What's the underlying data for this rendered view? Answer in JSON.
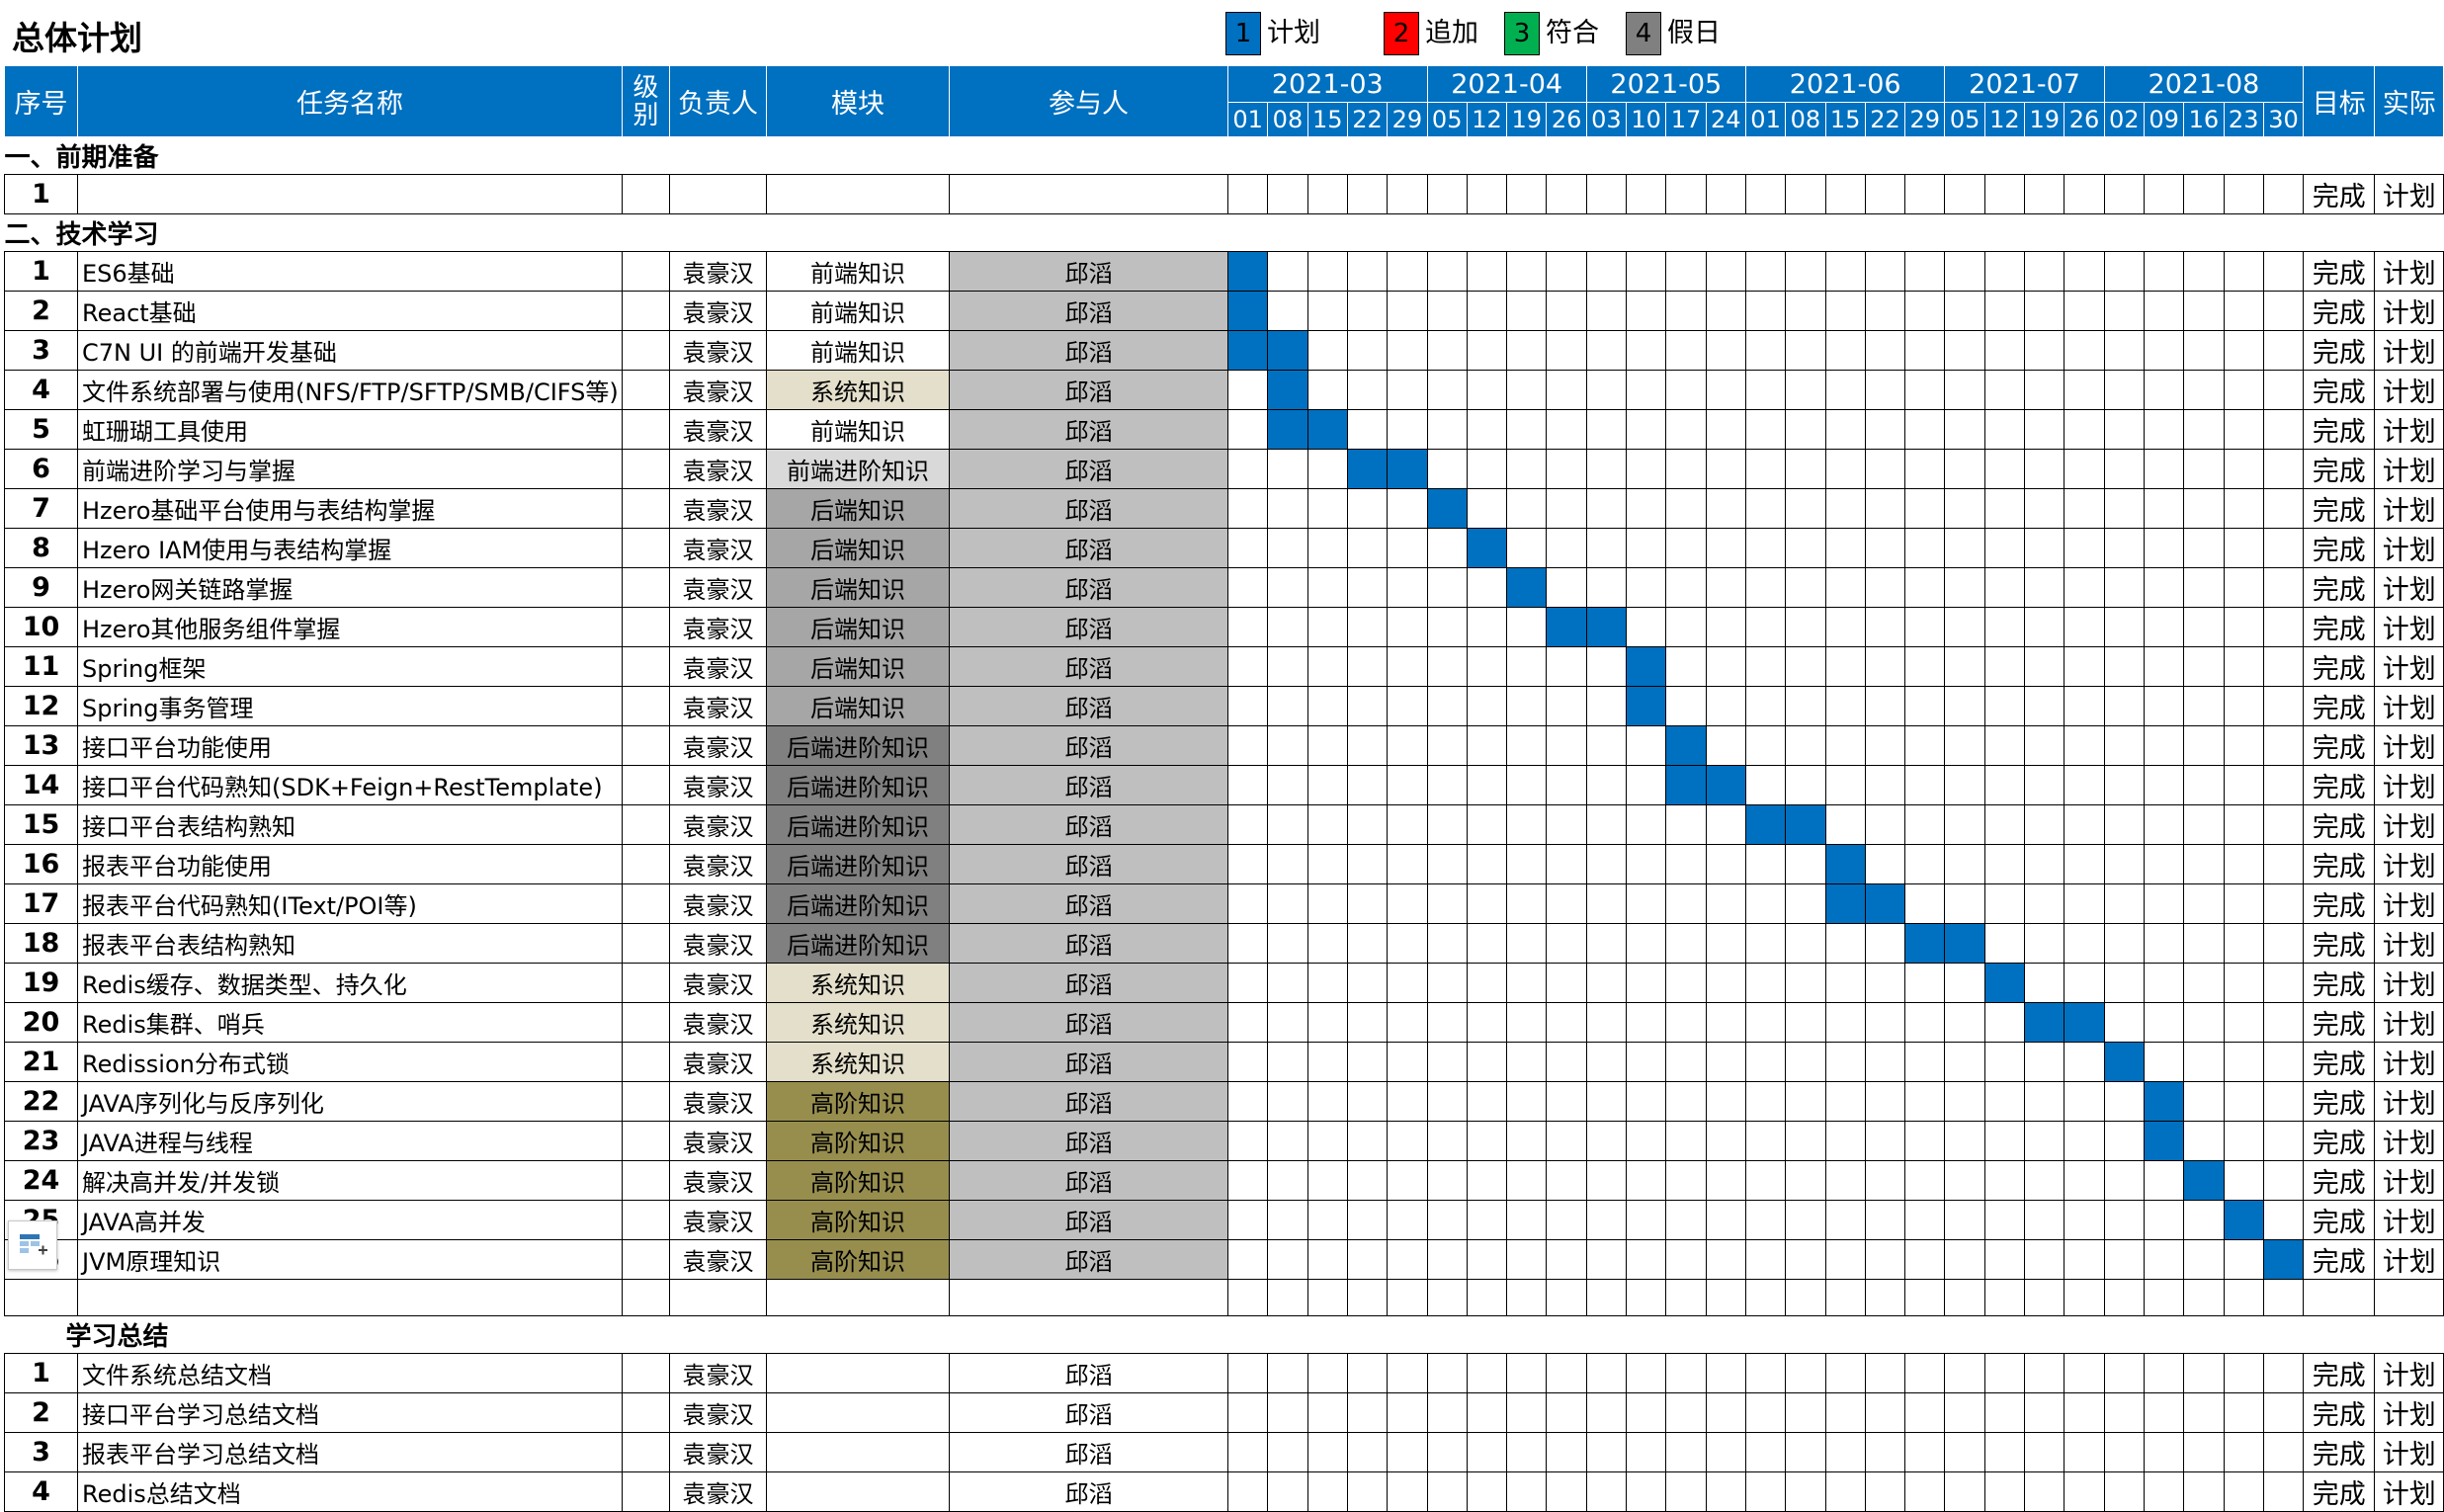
{
  "sheet_title": "总体计划",
  "legend": [
    {
      "num": "1",
      "label": "计划",
      "color": "#0070C0"
    },
    {
      "num": "2",
      "label": "追加",
      "color": "#FF0000"
    },
    {
      "num": "3",
      "label": "符合",
      "color": "#00B050"
    },
    {
      "num": "4",
      "label": "假日",
      "color": "#808080"
    }
  ],
  "headers": {
    "seq": "序号",
    "task": "任务名称",
    "level_1": "级",
    "level_2": "别",
    "owner": "负责人",
    "module": "模块",
    "participants": "参与人",
    "target": "目标",
    "actual": "实际"
  },
  "months": [
    {
      "label": "2021-03",
      "span": 5
    },
    {
      "label": "2021-04",
      "span": 4
    },
    {
      "label": "2021-05",
      "span": 4
    },
    {
      "label": "2021-06",
      "span": 5
    },
    {
      "label": "2021-07",
      "span": 4
    },
    {
      "label": "2021-08",
      "span": 5
    }
  ],
  "weeks": [
    "01",
    "08",
    "15",
    "22",
    "29",
    "05",
    "12",
    "19",
    "26",
    "03",
    "10",
    "17",
    "24",
    "01",
    "08",
    "15",
    "22",
    "29",
    "05",
    "12",
    "19",
    "26",
    "02",
    "09",
    "16",
    "23",
    "30"
  ],
  "sections": [
    {
      "title": "一、前期准备",
      "rows": [
        {
          "seq": "1",
          "task": "",
          "owner": "",
          "module": "",
          "module_style": "none",
          "participant": "",
          "participant_fill": false,
          "gantt": [],
          "target": "完成",
          "actual": "计划"
        }
      ]
    },
    {
      "title": "二、技术学习",
      "rows": [
        {
          "seq": "1",
          "task": "ES6基础",
          "owner": "袁豪汉",
          "module": "前端知识",
          "module_style": "front",
          "participant": "邱滔",
          "participant_fill": true,
          "gantt": [
            0
          ],
          "target": "完成",
          "actual": "计划"
        },
        {
          "seq": "2",
          "task": "React基础",
          "owner": "袁豪汉",
          "module": "前端知识",
          "module_style": "front",
          "participant": "邱滔",
          "participant_fill": true,
          "gantt": [
            0
          ],
          "target": "完成",
          "actual": "计划"
        },
        {
          "seq": "3",
          "task": "C7N UI 的前端开发基础",
          "owner": "袁豪汉",
          "module": "前端知识",
          "module_style": "front",
          "participant": "邱滔",
          "participant_fill": true,
          "gantt": [
            0,
            1
          ],
          "target": "完成",
          "actual": "计划"
        },
        {
          "seq": "4",
          "task": "文件系统部署与使用(NFS/FTP/SFTP/SMB/CIFS等)",
          "owner": "袁豪汉",
          "module": "系统知识",
          "module_style": "sys",
          "participant": "邱滔",
          "participant_fill": true,
          "gantt": [
            1
          ],
          "target": "完成",
          "actual": "计划"
        },
        {
          "seq": "5",
          "task": "虹珊瑚工具使用",
          "owner": "袁豪汉",
          "module": "前端知识",
          "module_style": "front",
          "participant": "邱滔",
          "participant_fill": true,
          "gantt": [
            1,
            2
          ],
          "target": "完成",
          "actual": "计划"
        },
        {
          "seq": "6",
          "task": "前端进阶学习与掌握",
          "owner": "袁豪汉",
          "module": "前端进阶知识",
          "module_style": "frontadv",
          "participant": "邱滔",
          "participant_fill": true,
          "gantt": [
            3,
            4
          ],
          "target": "完成",
          "actual": "计划"
        },
        {
          "seq": "7",
          "task": "Hzero基础平台使用与表结构掌握",
          "owner": "袁豪汉",
          "module": "后端知识",
          "module_style": "back",
          "participant": "邱滔",
          "participant_fill": true,
          "gantt": [
            5
          ],
          "target": "完成",
          "actual": "计划"
        },
        {
          "seq": "8",
          "task": "Hzero IAM使用与表结构掌握",
          "owner": "袁豪汉",
          "module": "后端知识",
          "module_style": "back",
          "participant": "邱滔",
          "participant_fill": true,
          "gantt": [
            6
          ],
          "target": "完成",
          "actual": "计划"
        },
        {
          "seq": "9",
          "task": "Hzero网关链路掌握",
          "owner": "袁豪汉",
          "module": "后端知识",
          "module_style": "back",
          "participant": "邱滔",
          "participant_fill": true,
          "gantt": [
            7
          ],
          "target": "完成",
          "actual": "计划"
        },
        {
          "seq": "10",
          "task": "Hzero其他服务组件掌握",
          "owner": "袁豪汉",
          "module": "后端知识",
          "module_style": "back",
          "participant": "邱滔",
          "participant_fill": true,
          "gantt": [
            8,
            9
          ],
          "target": "完成",
          "actual": "计划"
        },
        {
          "seq": "11",
          "task": "Spring框架",
          "owner": "袁豪汉",
          "module": "后端知识",
          "module_style": "back",
          "participant": "邱滔",
          "participant_fill": true,
          "gantt": [
            10
          ],
          "target": "完成",
          "actual": "计划"
        },
        {
          "seq": "12",
          "task": "Spring事务管理",
          "owner": "袁豪汉",
          "module": "后端知识",
          "module_style": "back",
          "participant": "邱滔",
          "participant_fill": true,
          "gantt": [
            10
          ],
          "target": "完成",
          "actual": "计划"
        },
        {
          "seq": "13",
          "task": "接口平台功能使用",
          "owner": "袁豪汉",
          "module": "后端进阶知识",
          "module_style": "backadv",
          "participant": "邱滔",
          "participant_fill": true,
          "gantt": [
            11
          ],
          "target": "完成",
          "actual": "计划"
        },
        {
          "seq": "14",
          "task": "接口平台代码熟知(SDK+Feign+RestTemplate)",
          "owner": "袁豪汉",
          "module": "后端进阶知识",
          "module_style": "backadv",
          "participant": "邱滔",
          "participant_fill": true,
          "gantt": [
            11,
            12
          ],
          "target": "完成",
          "actual": "计划"
        },
        {
          "seq": "15",
          "task": "接口平台表结构熟知",
          "owner": "袁豪汉",
          "module": "后端进阶知识",
          "module_style": "backadv",
          "participant": "邱滔",
          "participant_fill": true,
          "gantt": [
            13,
            14
          ],
          "target": "完成",
          "actual": "计划"
        },
        {
          "seq": "16",
          "task": "报表平台功能使用",
          "owner": "袁豪汉",
          "module": "后端进阶知识",
          "module_style": "backadv",
          "participant": "邱滔",
          "participant_fill": true,
          "gantt": [
            15
          ],
          "target": "完成",
          "actual": "计划"
        },
        {
          "seq": "17",
          "task": "报表平台代码熟知(IText/POI等)",
          "owner": "袁豪汉",
          "module": "后端进阶知识",
          "module_style": "backadv",
          "participant": "邱滔",
          "participant_fill": true,
          "gantt": [
            15,
            16
          ],
          "target": "完成",
          "actual": "计划"
        },
        {
          "seq": "18",
          "task": "报表平台表结构熟知",
          "owner": "袁豪汉",
          "module": "后端进阶知识",
          "module_style": "backadv",
          "participant": "邱滔",
          "participant_fill": true,
          "gantt": [
            17,
            18
          ],
          "target": "完成",
          "actual": "计划"
        },
        {
          "seq": "19",
          "task": "Redis缓存、数据类型、持久化",
          "owner": "袁豪汉",
          "module": "系统知识",
          "module_style": "sys",
          "participant": "邱滔",
          "participant_fill": true,
          "gantt": [
            19
          ],
          "target": "完成",
          "actual": "计划"
        },
        {
          "seq": "20",
          "task": "Redis集群、哨兵",
          "owner": "袁豪汉",
          "module": "系统知识",
          "module_style": "sys",
          "participant": "邱滔",
          "participant_fill": true,
          "gantt": [
            20,
            21
          ],
          "target": "完成",
          "actual": "计划"
        },
        {
          "seq": "21",
          "task": "Redission分布式锁",
          "owner": "袁豪汉",
          "module": "系统知识",
          "module_style": "sys",
          "participant": "邱滔",
          "participant_fill": true,
          "gantt": [
            22
          ],
          "target": "完成",
          "actual": "计划"
        },
        {
          "seq": "22",
          "task": "JAVA序列化与反序列化",
          "owner": "袁豪汉",
          "module": "高阶知识",
          "module_style": "high",
          "participant": "邱滔",
          "participant_fill": true,
          "gantt": [
            23
          ],
          "target": "完成",
          "actual": "计划"
        },
        {
          "seq": "23",
          "task": "JAVA进程与线程",
          "owner": "袁豪汉",
          "module": "高阶知识",
          "module_style": "high",
          "participant": "邱滔",
          "participant_fill": true,
          "gantt": [
            23
          ],
          "target": "完成",
          "actual": "计划"
        },
        {
          "seq": "24",
          "task": "解决高并发/并发锁",
          "owner": "袁豪汉",
          "module": "高阶知识",
          "module_style": "high",
          "participant": "邱滔",
          "participant_fill": true,
          "gantt": [
            24
          ],
          "target": "完成",
          "actual": "计划"
        },
        {
          "seq": "25",
          "task": "JAVA高并发",
          "owner": "袁豪汉",
          "module": "高阶知识",
          "module_style": "high",
          "participant": "邱滔",
          "participant_fill": true,
          "gantt": [
            25
          ],
          "target": "完成",
          "actual": "计划"
        },
        {
          "seq": "26",
          "task": "JVM原理知识",
          "owner": "袁豪汉",
          "module": "高阶知识",
          "module_style": "high",
          "participant": "邱滔",
          "participant_fill": true,
          "gantt": [
            26
          ],
          "target": "完成",
          "actual": "计划"
        },
        {
          "seq": "",
          "task": "",
          "owner": "",
          "module": "",
          "module_style": "none",
          "participant": "",
          "participant_fill": false,
          "gantt": [],
          "target": "",
          "actual": "",
          "blank": true
        }
      ]
    },
    {
      "title": "学习总结",
      "title_hidden_prefix": true,
      "rows": [
        {
          "seq": "1",
          "task": "文件系统总结文档",
          "owner": "袁豪汉",
          "module": "",
          "module_style": "none",
          "participant": "邱滔",
          "participant_fill": false,
          "gantt": [],
          "target": "完成",
          "actual": "计划"
        },
        {
          "seq": "2",
          "task": "接口平台学习总结文档",
          "owner": "袁豪汉",
          "module": "",
          "module_style": "none",
          "participant": "邱滔",
          "participant_fill": false,
          "gantt": [],
          "target": "完成",
          "actual": "计划"
        },
        {
          "seq": "3",
          "task": "报表平台学习总结文档",
          "owner": "袁豪汉",
          "module": "",
          "module_style": "none",
          "participant": "邱滔",
          "participant_fill": false,
          "gantt": [],
          "target": "完成",
          "actual": "计划"
        },
        {
          "seq": "4",
          "task": "Redis总结文档",
          "owner": "袁豪汉",
          "module": "",
          "module_style": "none",
          "participant": "邱滔",
          "participant_fill": false,
          "gantt": [],
          "target": "完成",
          "actual": "计划"
        }
      ]
    }
  ],
  "icons": {
    "add_row": "insert-table-icon"
  }
}
